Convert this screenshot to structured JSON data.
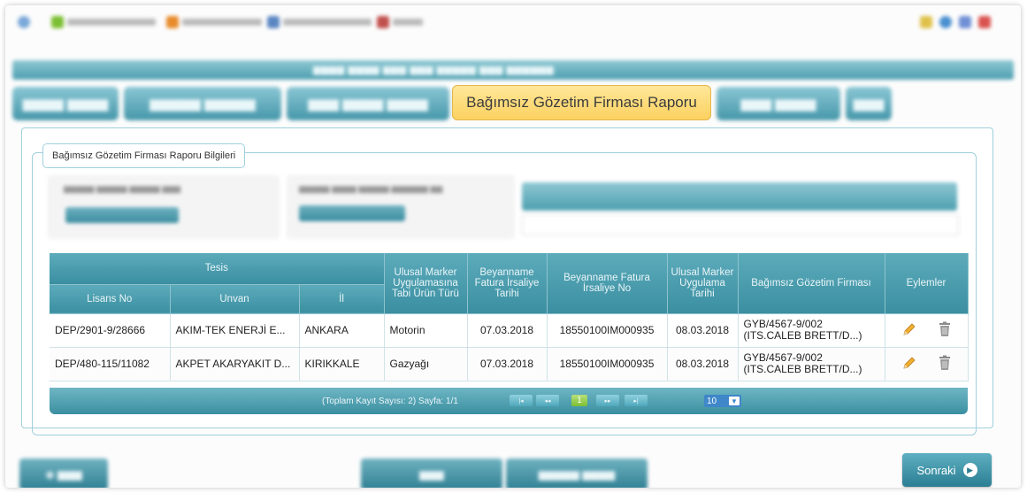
{
  "tabs": {
    "active_label": "Bağımsız Gözetim Firması Raporu"
  },
  "section": {
    "legend": "Bağımsız Gözetim Firması Raporu Bilgileri"
  },
  "table": {
    "group_header": "Tesis",
    "headers": {
      "lisans_no": "Lisans No",
      "unvan": "Unvan",
      "il": "İl",
      "urun_turu": "Ulusal Marker Uygulamasına Tabi Ürün Türü",
      "fatura_tarihi": "Beyanname Fatura İrsaliye Tarihi",
      "fatura_no": "Beyanname Fatura İrsaliye No",
      "uygulama_tarihi": "Ulusal Marker Uygulama Tarihi",
      "firma": "Bağımsız Gözetim Firması",
      "eylemler": "Eylemler"
    },
    "rows": [
      {
        "lisans_no": "DEP/2901-9/28666",
        "unvan": "AKIM-TEK ENERJİ E...",
        "il": "ANKARA",
        "urun_turu": "Motorin",
        "fatura_tarihi": "07.03.2018",
        "fatura_no": "18550100IM000935",
        "uygulama_tarihi": "08.03.2018",
        "firma": "GYB/4567-9/002 (ITS.CALEB BRETT/D...)"
      },
      {
        "lisans_no": "DEP/480-115/11082",
        "unvan": "AKPET AKARYAKIT D...",
        "il": "KIRIKKALE",
        "urun_turu": "Gazyağı",
        "fatura_tarihi": "07.03.2018",
        "fatura_no": "18550100IM000935",
        "uygulama_tarihi": "08.03.2018",
        "firma": "GYB/4567-9/002 (ITS.CALEB BRETT/D...)"
      }
    ]
  },
  "pager": {
    "summary": "(Toplam Kayıt Sayısı: 2) Sayfa: 1/1",
    "current_page": "1",
    "page_size": "10"
  },
  "footer": {
    "next_label": "Sonraki"
  },
  "colors": {
    "accent": "#4597aa",
    "active_tab": "#fcd160",
    "edit_icon": "#e8a21a",
    "delete_icon": "#8a8a8a"
  }
}
